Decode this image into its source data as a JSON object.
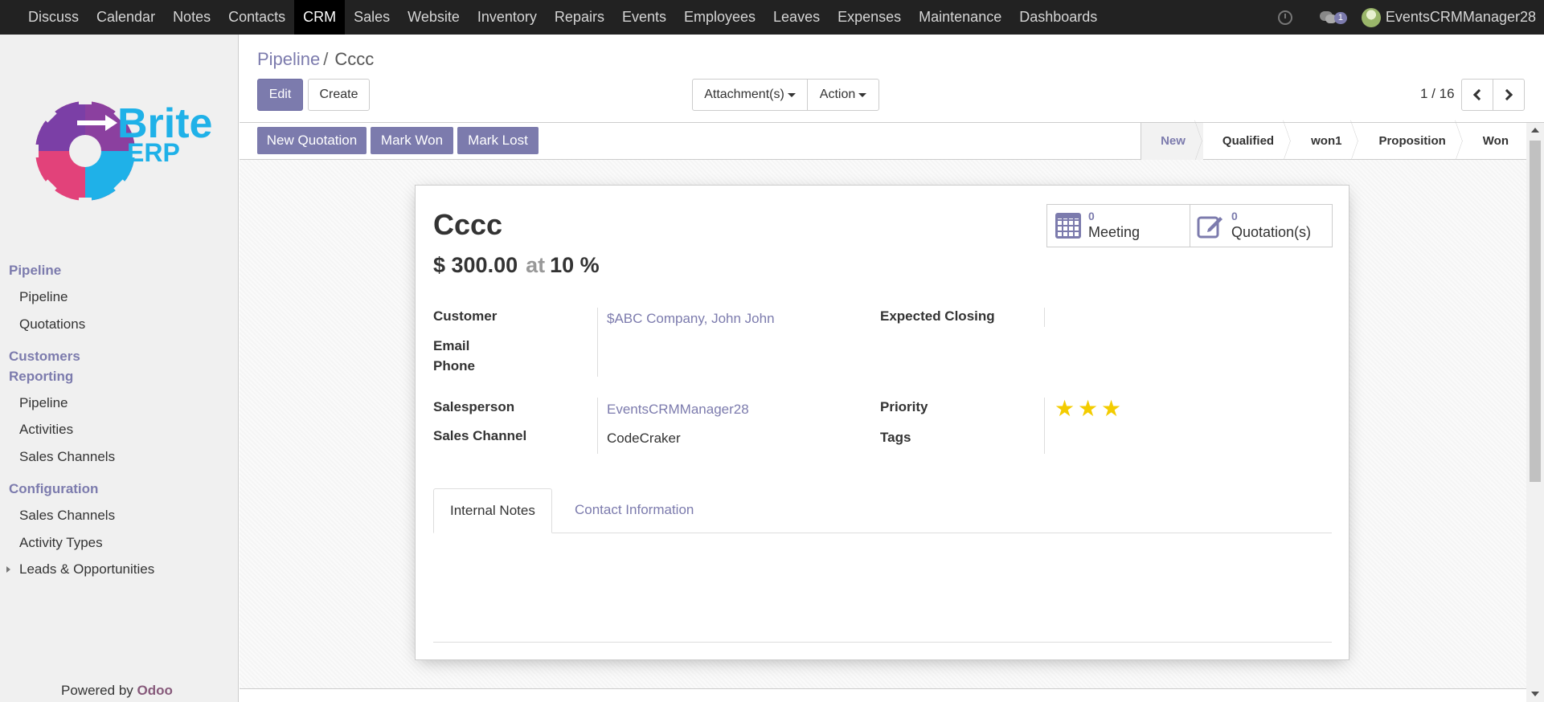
{
  "topbar": {
    "menu": [
      "Discuss",
      "Calendar",
      "Notes",
      "Contacts",
      "CRM",
      "Sales",
      "Website",
      "Inventory",
      "Repairs",
      "Events",
      "Employees",
      "Leaves",
      "Expenses",
      "Maintenance",
      "Dashboards"
    ],
    "active": "CRM",
    "chat_count": "1",
    "username": "EventsCRMManager28"
  },
  "sidebar": {
    "logo_text": [
      "Brite",
      "ERP"
    ],
    "sections": [
      {
        "title": "Pipeline",
        "items": [
          "Pipeline",
          "Quotations"
        ]
      },
      {
        "title": "Customers",
        "items": []
      },
      {
        "title": "Reporting",
        "items": [
          "Pipeline",
          "Activities",
          "Sales Channels"
        ]
      },
      {
        "title": "Configuration",
        "items": [
          "Sales Channels",
          "Activity Types",
          "Leads & Opportunities"
        ]
      }
    ],
    "powered_by": "Powered by",
    "powered_brand": "Odoo"
  },
  "control": {
    "breadcrumb_parent": "Pipeline",
    "breadcrumb_sep": "/",
    "breadcrumb_current": "Cccc",
    "edit": "Edit",
    "create": "Create",
    "attachments": "Attachment(s)",
    "action": "Action",
    "pager": "1 / 16"
  },
  "statusbar": {
    "buttons": [
      "New Quotation",
      "Mark Won",
      "Mark Lost"
    ],
    "stages": [
      "New",
      "Qualified",
      "won1",
      "Proposition",
      "Won"
    ],
    "current_stage": "New"
  },
  "record": {
    "name": "Cccc",
    "revenue": "$ 300.00",
    "at": "at",
    "probability": "10 %",
    "meetings_count": "0",
    "meetings_label": "Meeting",
    "quotations_count": "0",
    "quotations_label": "Quotation(s)",
    "fields": {
      "customer_label": "Customer",
      "customer_value": "$ABC Company, John John",
      "email_label": "Email",
      "phone_label": "Phone",
      "expected_closing_label": "Expected Closing",
      "salesperson_label": "Salesperson",
      "salesperson_value": "EventsCRMManager28",
      "sales_channel_label": "Sales Channel",
      "sales_channel_value": "CodeCraker",
      "priority_label": "Priority",
      "priority_stars": 3,
      "tags_label": "Tags"
    },
    "tabs": [
      "Internal Notes",
      "Contact Information"
    ]
  },
  "colors": {
    "accent": "#7c7bad",
    "topbar": "#222222",
    "star": "#f3cc00",
    "odoo": "#875a7b"
  }
}
